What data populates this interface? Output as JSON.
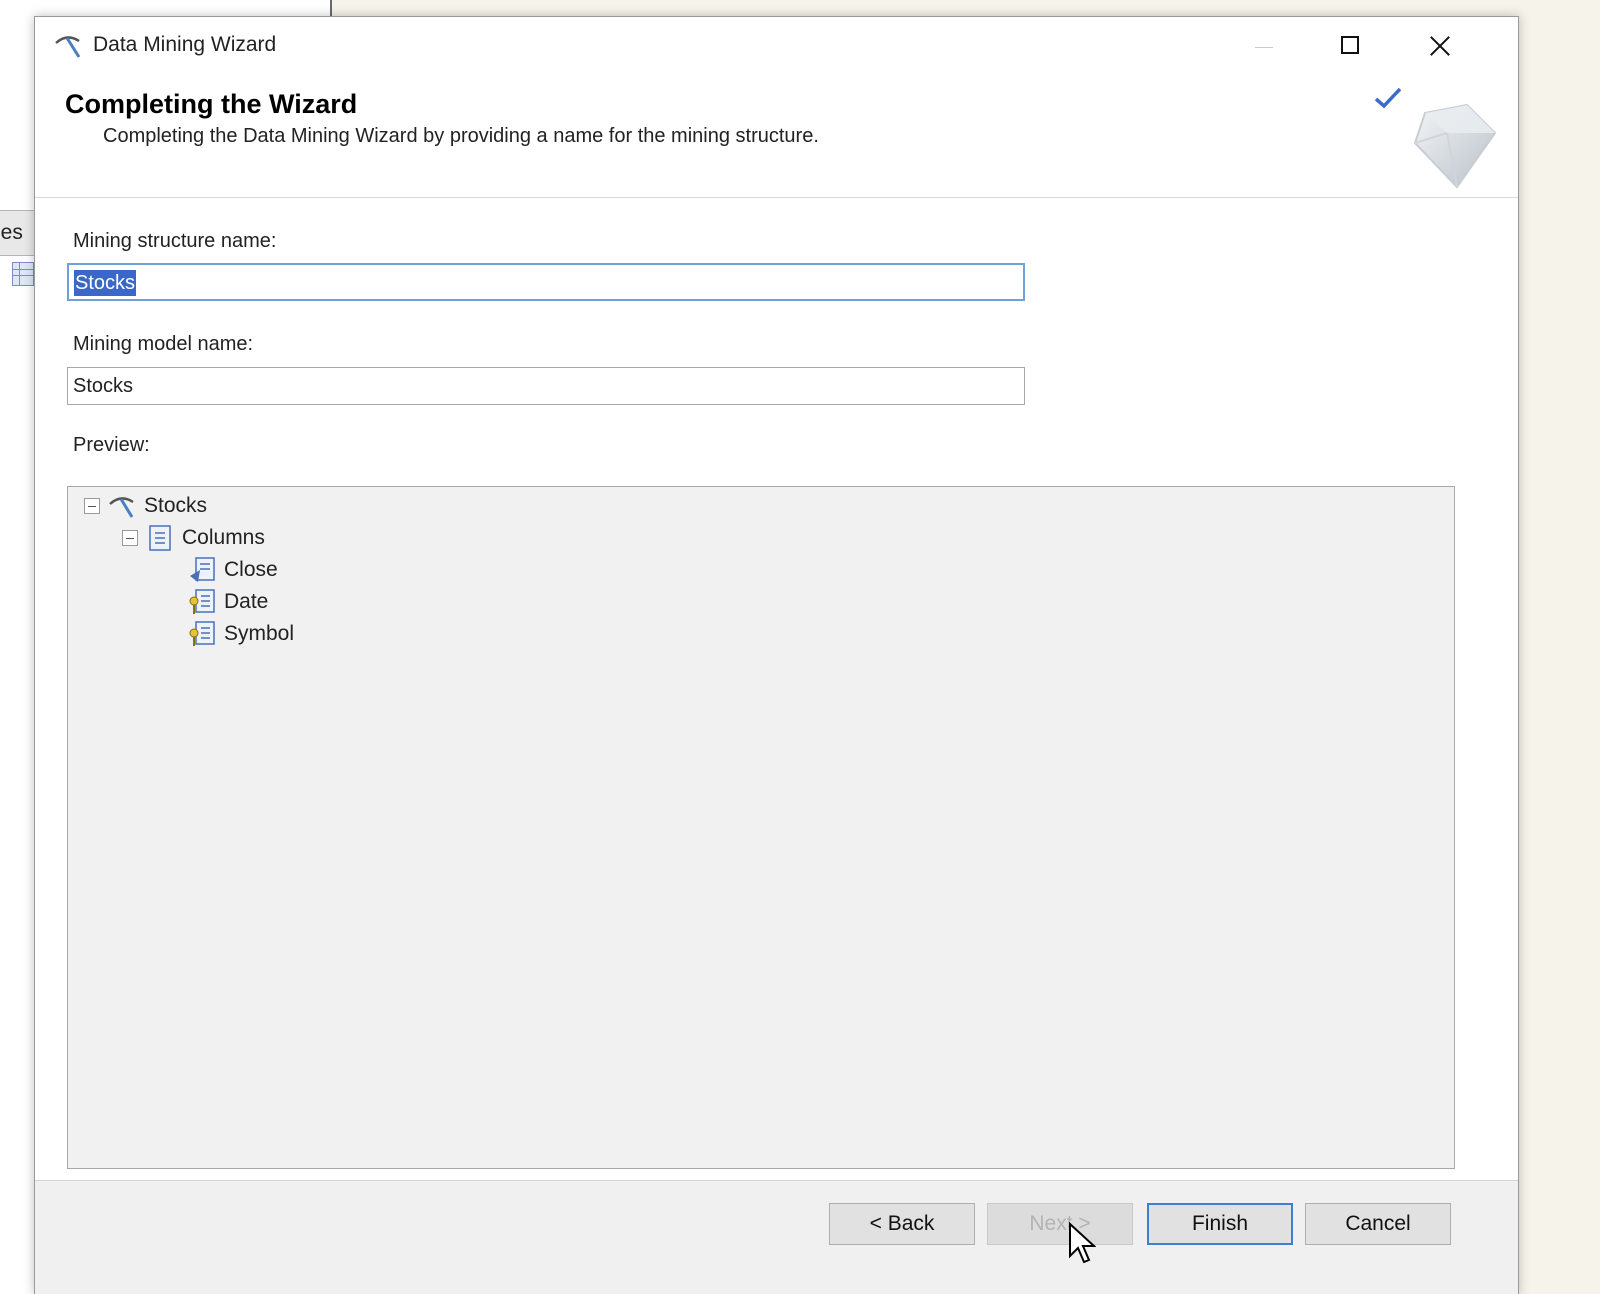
{
  "background": {
    "tab_label": "les"
  },
  "window": {
    "title": "Data Mining Wizard",
    "title_icon": "mining-pick-icon"
  },
  "header": {
    "title": "Completing the Wizard",
    "subtitle": "Completing the Data Mining Wizard by providing a name for the mining structure."
  },
  "form": {
    "structure_label": "Mining structure name:",
    "structure_value": "Stocks",
    "model_label": "Mining model name:",
    "model_value": "Stocks",
    "preview_label": "Preview:"
  },
  "tree": {
    "root": {
      "label": "Stocks",
      "icon": "mining-structure-icon",
      "expanded": true
    },
    "columns": {
      "label": "Columns",
      "icon": "columns-folder-icon",
      "expanded": true
    },
    "items": [
      {
        "label": "Close",
        "icon": "predict-column-icon"
      },
      {
        "label": "Date",
        "icon": "key-column-icon"
      },
      {
        "label": "Symbol",
        "icon": "key-column-icon"
      }
    ]
  },
  "buttons": {
    "back": "< Back",
    "next": "Next >",
    "finish": "Finish",
    "cancel": "Cancel"
  },
  "colors": {
    "selection": "#3b67c8",
    "focus_border": "#6fa0d8",
    "default_button_border": "#3c7fd3"
  }
}
